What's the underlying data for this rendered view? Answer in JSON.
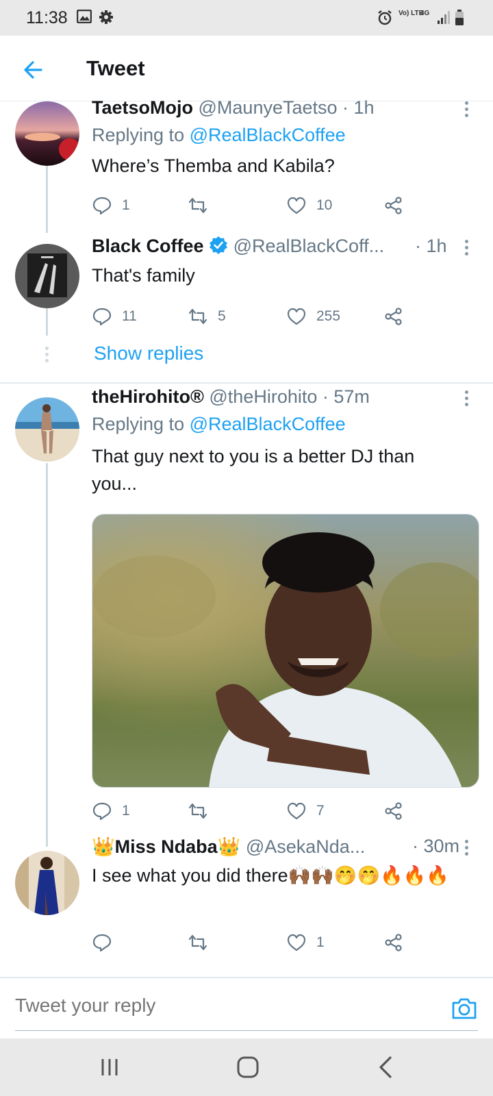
{
  "status_bar": {
    "time": "11:38",
    "network": "Vo) LTE",
    "signal_type": "4G"
  },
  "header": {
    "title": "Tweet"
  },
  "tweets": [
    {
      "name": "TaetsoMojo",
      "handle": "@MaunyeTaetso",
      "time": "· 1h",
      "replying_label": "Replying to",
      "replying_to": "@RealBlackCoffee",
      "text": "Where’s Themba and Kabila?",
      "replies": "1",
      "retweets": "",
      "likes": "10"
    },
    {
      "name": "Black Coffee",
      "verified": true,
      "handle": "@RealBlackCoff...",
      "time": "· 1h",
      "text": "That's family",
      "replies": "11",
      "retweets": "5",
      "likes": "255",
      "show_replies": "Show replies"
    },
    {
      "name": "theHirohito®",
      "handle": "@theHirohito",
      "time": "· 57m",
      "replying_label": "Replying to",
      "replying_to": "@RealBlackCoffee",
      "text": "That guy next to you is a better DJ than you...",
      "replies": "1",
      "retweets": "",
      "likes": "7"
    },
    {
      "name_prefix": "👑",
      "name": "Miss Ndaba",
      "name_suffix": "👑",
      "handle": "@AsekaNda...",
      "time": "· 30m",
      "text": "I see what you did there🙌🏾🙌🏾🤭🤭🔥🔥🔥",
      "replies": "",
      "retweets": "",
      "likes": "1"
    }
  ],
  "reply_bar": {
    "placeholder": "Tweet your reply"
  },
  "icons": {
    "back": "arrow-left-icon",
    "reply": "comment-icon",
    "retweet": "retweet-icon",
    "like": "heart-icon",
    "share": "share-icon",
    "camera": "camera-icon"
  },
  "colors": {
    "accent": "#1da1f2",
    "secondary_text": "#657786",
    "primary_text": "#14171a"
  }
}
